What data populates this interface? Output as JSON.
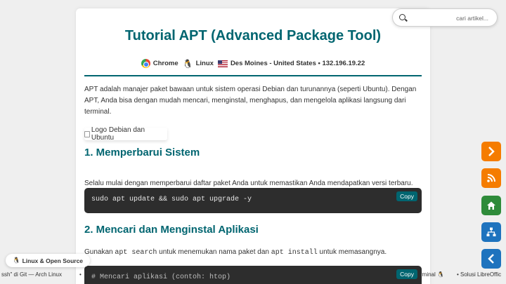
{
  "article": {
    "title": "Tutorial APT (Advanced Package Tool)",
    "meta": {
      "browser": "Chrome",
      "os": "Linux",
      "location": "Des Moines - United States • 132.196.19.22"
    },
    "intro": "APT adalah manajer paket bawaan untuk sistem operasi Debian dan turunannya (seperti Ubuntu). Dengan APT, Anda bisa dengan mudah mencari, menginstal, menghapus, dan mengelola aplikasi langsung dari terminal.",
    "image_alt": "Logo Debian dan Ubuntu",
    "sections": [
      {
        "heading": "1. Memperbarui Sistem",
        "text": "Selalu mulai dengan memperbarui daftar paket Anda untuk memastikan Anda mendapatkan versi terbaru.",
        "code": "sudo apt update && sudo apt upgrade -y",
        "copy_label": "Copy"
      },
      {
        "heading": "2. Mencari dan Menginstal Aplikasi",
        "text_before": "Gunakan",
        "cmd1": "apt search",
        "text_mid": "untuk menemukan nama paket dan",
        "cmd2": "apt install",
        "text_after": "untuk memasangnya.",
        "code": "# Mencari aplikasi (contoh: htop)",
        "copy_label": "Copy"
      }
    ]
  },
  "search": {
    "placeholder": "cari artikel..."
  },
  "fabs": [
    {
      "icon": "chevron-right-icon",
      "color": "#f57c00"
    },
    {
      "icon": "rss-icon",
      "color": "#f57c00"
    },
    {
      "icon": "home-icon",
      "color": "#2e8b3a"
    },
    {
      "icon": "sitemap-icon",
      "color": "#1e73be"
    },
    {
      "icon": "chevron-left-icon",
      "color": "#1e73be"
    }
  ],
  "footer": {
    "badge": "Linux & Open Source",
    "ticker": [
      "ssh\" di Git — Arch Linux",
      "•",
      "rminal 🐧",
      "•  Solusi LibreOffic"
    ]
  }
}
